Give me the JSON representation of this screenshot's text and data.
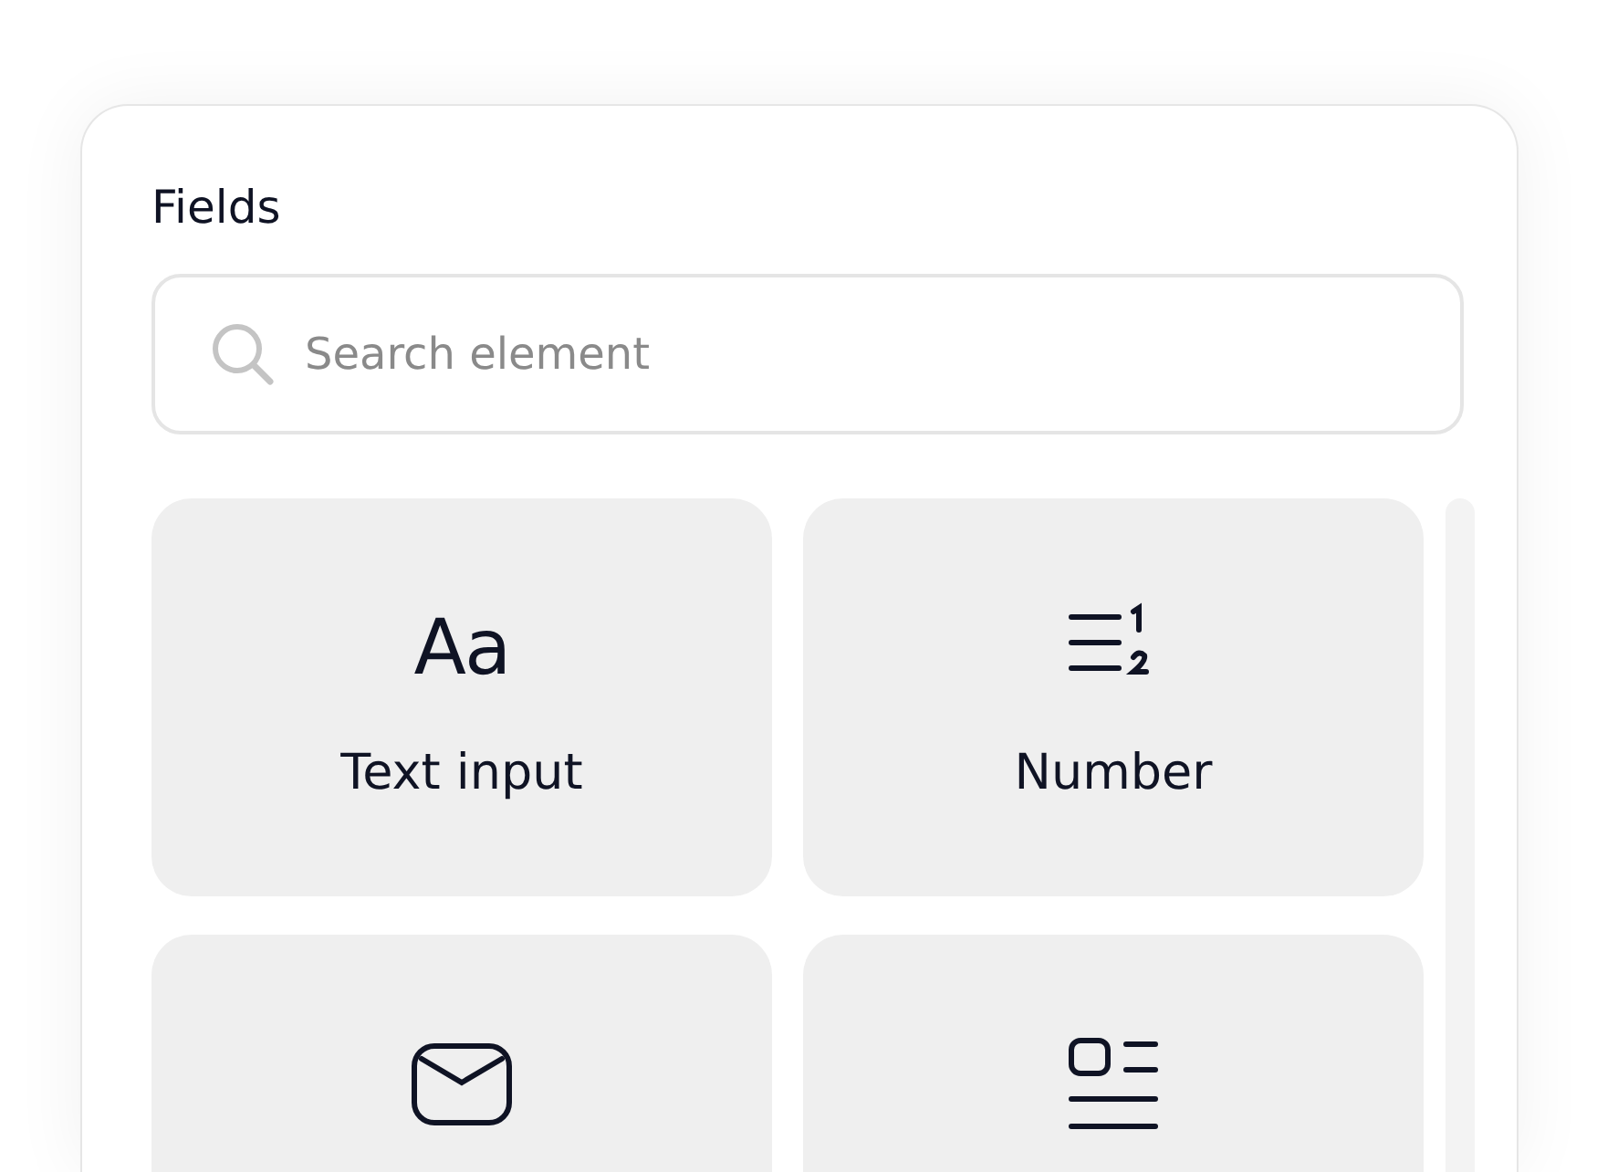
{
  "panel": {
    "title": "Fields",
    "search": {
      "placeholder": "Search element"
    },
    "tiles": [
      {
        "kind": "text",
        "glyph": "Aa",
        "label": "Text input"
      },
      {
        "kind": "number",
        "label": "Number"
      },
      {
        "kind": "email"
      },
      {
        "kind": "form"
      }
    ]
  }
}
